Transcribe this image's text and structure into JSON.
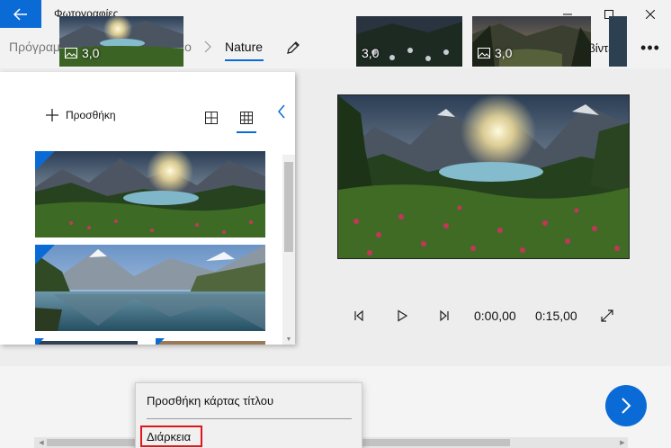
{
  "app": {
    "title": "Φωτογραφίες"
  },
  "breadcrumb": {
    "parent": "Πρόγραμμα επεξεργασίας βίντεο",
    "current": "Nature"
  },
  "toolbar": {
    "finish_label": "Ολοκλήρωση βίντεο"
  },
  "library": {
    "add_label": "Προσθήκη"
  },
  "player": {
    "current_time": "0:00,00",
    "total_time": "0:15,00"
  },
  "storyboard": {
    "clips": [
      {
        "duration": "3,0"
      },
      {
        "duration": "3,0"
      },
      {
        "duration": "3,0"
      }
    ]
  },
  "context_menu": {
    "items": [
      {
        "label": "Προσθήκη κάρτας τίτλου"
      },
      {
        "label": "Διάρκεια"
      }
    ]
  },
  "colors": {
    "accent": "#0b6bd6",
    "highlight": "#e0161b"
  }
}
